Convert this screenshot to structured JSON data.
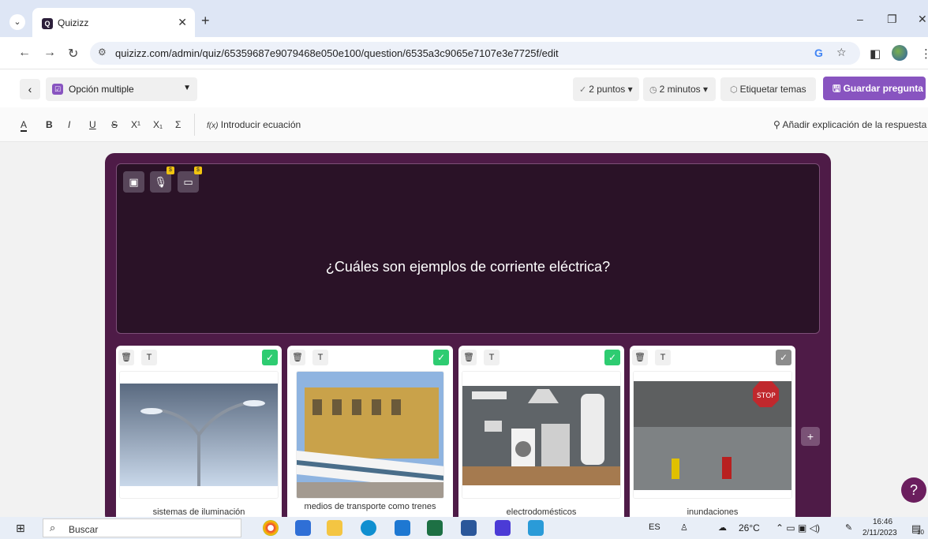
{
  "browser": {
    "tab_title": "Quizizz",
    "url": "quizizz.com/admin/quiz/65359687e9079468e050e100/question/6535a3c9065e7107e3e7725f/edit",
    "tab_close": "✕",
    "new_tab": "+"
  },
  "header": {
    "question_type": "Opción multiple",
    "points": "2 puntos",
    "time": "2 minutos",
    "tag_topics": "Etiquetar temas",
    "save": "Guardar pregunta"
  },
  "toolbar": {
    "bold": "B",
    "italic": "I",
    "underline": "U",
    "strike": "S",
    "superscript": "X¹",
    "subscript": "X₁",
    "sigma": "Σ",
    "text_color": "A",
    "equation": "Introducir ecuación",
    "equation_icon": "f(x)",
    "add_explanation": "Añadir explicación de la respuesta"
  },
  "question": {
    "text": "¿Cuáles son ejemplos de corriente eléctrica?"
  },
  "answers": [
    {
      "label": "sistemas de iluminación",
      "correct": true
    },
    {
      "label": "medios de transporte como trenes",
      "correct": true
    },
    {
      "label": "electrodomésticos",
      "correct": true
    },
    {
      "label": "inundaciones",
      "correct": false
    }
  ],
  "taskbar": {
    "search": "Buscar",
    "lang": "ES",
    "weather": "26°C",
    "time": "16:46",
    "date": "2/11/2023",
    "notif": "10"
  },
  "colors": {
    "accent": "#8854c0",
    "editor_bg": "#4e1b47",
    "question_bg": "#2a1227",
    "correct_green": "#2ecc71",
    "incorrect_gray": "#8c8c8c"
  }
}
